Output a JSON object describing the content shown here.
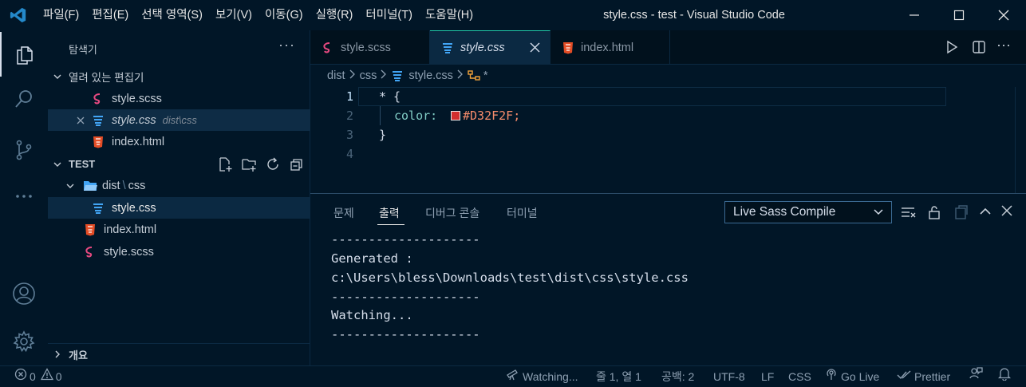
{
  "titlebar": {
    "menus": [
      "파일(F)",
      "편집(E)",
      "선택 영역(S)",
      "보기(V)",
      "이동(G)",
      "실행(R)",
      "터미널(T)",
      "도움말(H)"
    ],
    "window_title": "style.css - test - Visual Studio Code"
  },
  "sidebar": {
    "title": "탐색기",
    "open_editors_label": "열려 있는 편집기",
    "open_editors": [
      {
        "name": "style.scss",
        "desc": "",
        "icon": "sass-icon"
      },
      {
        "name": "style.css",
        "desc": "dist\\css",
        "icon": "css-icon"
      },
      {
        "name": "index.html",
        "desc": "",
        "icon": "html-icon"
      }
    ],
    "project_label": "TEST",
    "tree": {
      "folder": "dist",
      "subfolder": "css",
      "files": [
        "style.css",
        "index.html",
        "style.scss"
      ]
    },
    "outline_label": "개요"
  },
  "tabs": [
    {
      "label": "style.scss",
      "icon": "sass-icon"
    },
    {
      "label": "style.css",
      "icon": "css-icon"
    },
    {
      "label": "index.html",
      "icon": "html-icon"
    }
  ],
  "breadcrumb": {
    "parts": [
      "dist",
      "css",
      "style.css",
      "*"
    ]
  },
  "code": {
    "lines": [
      {
        "num": "1",
        "text": "* {"
      },
      {
        "num": "2",
        "prop": "color:",
        "value": "#D32F2F;"
      },
      {
        "num": "3",
        "text": "}"
      },
      {
        "num": "4",
        "text": ""
      }
    ],
    "swatch_color": "#D32F2F"
  },
  "panel": {
    "tabs": [
      "문제",
      "출력",
      "디버그 콘솔",
      "터미널"
    ],
    "output_channel": "Live Sass Compile",
    "output": [
      "--------------------",
      "Generated :",
      "c:\\Users\\bless\\Downloads\\test\\dist\\css\\style.css",
      "--------------------",
      "Watching...",
      "--------------------"
    ]
  },
  "statusbar": {
    "errors": "0",
    "warnings": "0",
    "watching": "Watching...",
    "position": "줄 1, 열 1",
    "indent": "공백: 2",
    "encoding": "UTF-8",
    "eol": "LF",
    "language": "CSS",
    "golive": "Go Live",
    "prettier": "Prettier"
  },
  "colors": {
    "accent": "#21c7a8",
    "sass": "#e64980",
    "css": "#42a5f5",
    "html": "#e44d26",
    "vscode_blue": "#2489ca"
  }
}
